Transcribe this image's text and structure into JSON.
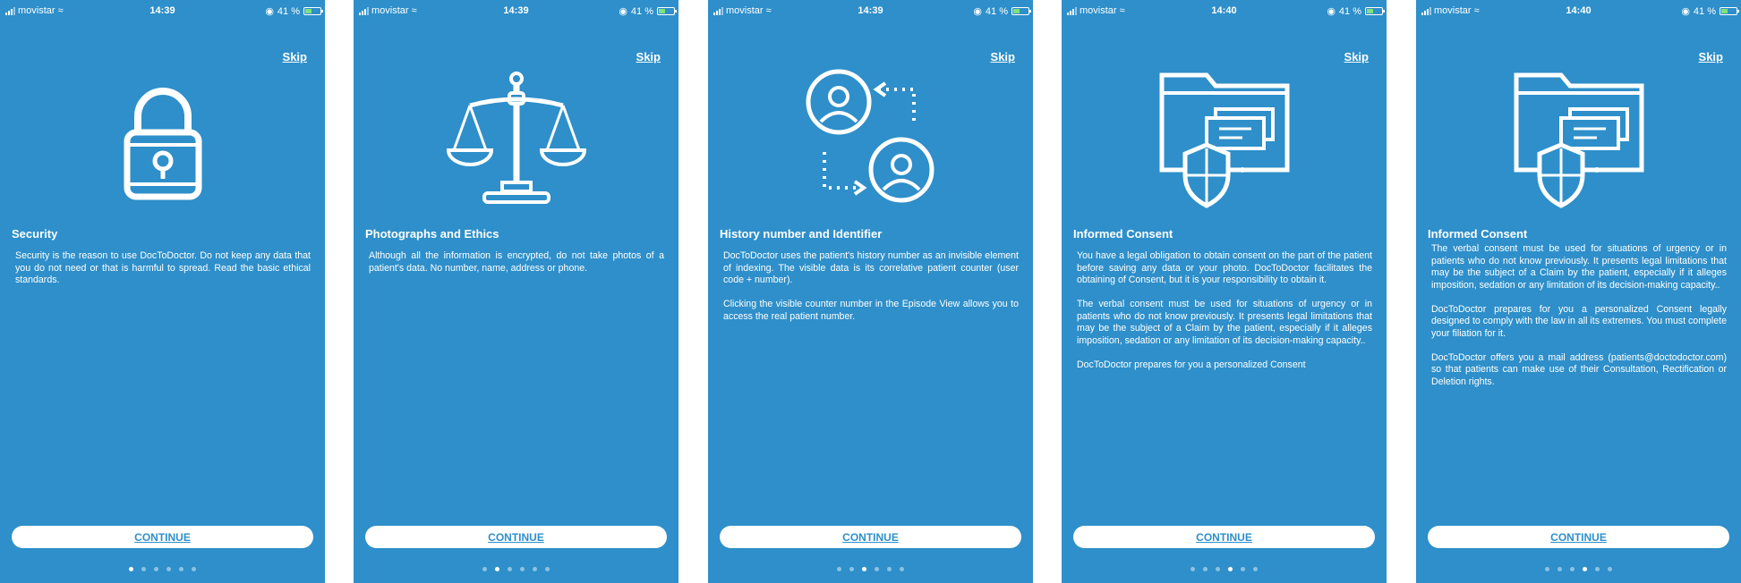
{
  "screens": [
    {
      "carrier": "movistar",
      "time": "14:39",
      "battery": "41 %",
      "skip": "Skip",
      "icon": "padlock-icon",
      "title": "Security",
      "body": "Security is the reason to use DocToDoctor. Do not keep any data that you do not need or that is harmful to spread. Read the basic ethical standards.",
      "continue": "CONTINUE",
      "active_dot": 0
    },
    {
      "carrier": "movistar",
      "time": "14:39",
      "battery": "41 %",
      "skip": "Skip",
      "icon": "scales-icon",
      "title": "Photographs and Ethics",
      "body": "Although all the information is encrypted, do not take photos of a patient's data. No number, name, address or phone.",
      "continue": "CONTINUE",
      "active_dot": 1
    },
    {
      "carrier": "movistar",
      "time": "14:39",
      "battery": "41 %",
      "skip": "Skip",
      "icon": "user-exchange-icon",
      "title": "History number and Identifier",
      "body": "DocToDoctor uses the patient's history number as an invisible element of indexing. The visible data is its correlative patient counter (user code + number).\n\n Clicking the visible counter number in the Episode View allows you to access the real patient number.",
      "continue": "CONTINUE",
      "active_dot": 2
    },
    {
      "carrier": "movistar",
      "time": "14:40",
      "battery": "41 %",
      "skip": "Skip",
      "icon": "folder-shield-icon",
      "title": "Informed Consent",
      "body": "You have a legal obligation to obtain consent on the part of the patient before saving any data or your photo. DocToDoctor facilitates the obtaining of Consent, but it is your responsibility to obtain it.\n\nThe verbal consent must be used for situations of urgency or in patients who do not know previously. It presents legal limitations that may be the subject of a Claim by the patient, especially if it alleges imposition, sedation or any limitation of its decision-making capacity..\n\nDocToDoctor prepares for you a personalized Consent",
      "continue": "CONTINUE",
      "active_dot": 3
    },
    {
      "carrier": "movistar",
      "time": "14:40",
      "battery": "41 %",
      "skip": "Skip",
      "icon": "folder-shield-icon",
      "title": "Informed Consent",
      "body": "The verbal consent must be used for situations of urgency or in patients who do not know previously. It presents legal limitations that may be the subject of a Claim by the patient, especially if it alleges imposition, sedation or any limitation of its decision-making capacity..\n\nDocToDoctor prepares for you a personalized Consent legally designed to comply with the law in all its extremes. You must complete your filiation for it.\n\nDocToDoctor offers you a mail address (patients@doctodoctor.com) so that patients can make use of their Consultation, Rectification or Deletion rights.",
      "continue": "CONTINUE",
      "active_dot": 3
    }
  ]
}
